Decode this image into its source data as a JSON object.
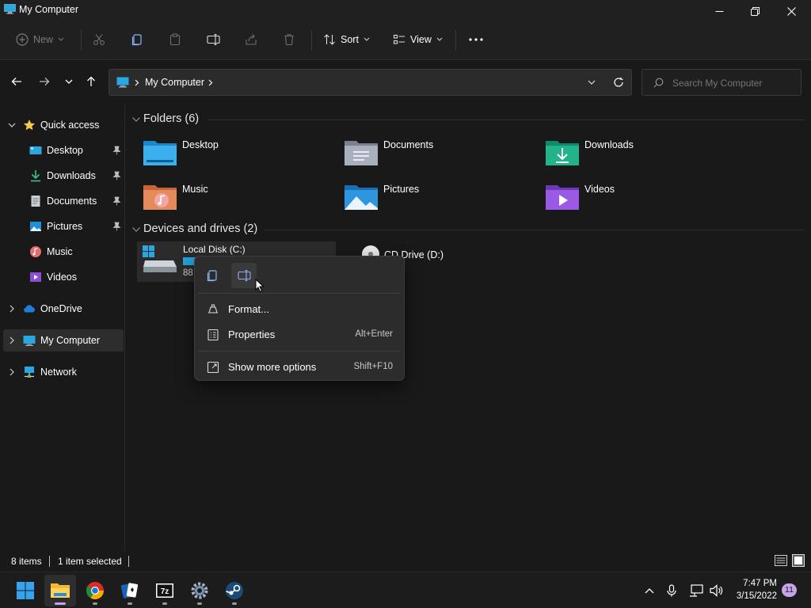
{
  "window": {
    "title": "My Computer",
    "controls": [
      "minimize-icon",
      "restore-icon",
      "close-icon"
    ]
  },
  "toolbar": {
    "new_label": "New",
    "sort_label": "Sort",
    "view_label": "View",
    "icons": [
      "cut-icon",
      "copy-icon",
      "paste-icon",
      "rename-icon",
      "share-icon",
      "delete-icon",
      "more-icon"
    ]
  },
  "address": {
    "breadcrumb": "My Computer",
    "search_placeholder": "Search My Computer"
  },
  "sidebar": {
    "quick_access": "Quick access",
    "items": [
      {
        "label": "Desktop",
        "icon": "desktop-icon",
        "pinned": true
      },
      {
        "label": "Downloads",
        "icon": "downloads-icon",
        "pinned": true
      },
      {
        "label": "Documents",
        "icon": "documents-icon",
        "pinned": true
      },
      {
        "label": "Pictures",
        "icon": "pictures-icon",
        "pinned": true
      },
      {
        "label": "Music",
        "icon": "music-icon",
        "pinned": false
      },
      {
        "label": "Videos",
        "icon": "videos-icon",
        "pinned": false
      }
    ],
    "onedrive": "OneDrive",
    "my_computer": "My Computer",
    "network": "Network"
  },
  "content": {
    "folders_heading": "Folders (6)",
    "folders": [
      {
        "label": "Desktop",
        "icon": "desktop-folder-icon"
      },
      {
        "label": "Documents",
        "icon": "documents-folder-icon"
      },
      {
        "label": "Downloads",
        "icon": "downloads-folder-icon"
      },
      {
        "label": "Music",
        "icon": "music-folder-icon"
      },
      {
        "label": "Pictures",
        "icon": "pictures-folder-icon"
      },
      {
        "label": "Videos",
        "icon": "videos-folder-icon"
      }
    ],
    "drives_heading": "Devices and drives (2)",
    "drive_c": {
      "label": "Local Disk (C:)",
      "free_text": "88",
      "used_fraction": 0.1
    },
    "drive_d": {
      "label": "CD Drive (D:)"
    }
  },
  "context_menu": {
    "top_icons": [
      "copy-icon",
      "rename-icon"
    ],
    "items": [
      {
        "label": "Format...",
        "shortcut": "",
        "icon": "format-icon"
      },
      {
        "label": "Properties",
        "shortcut": "Alt+Enter",
        "icon": "properties-icon"
      },
      {
        "label": "Show more options",
        "shortcut": "Shift+F10",
        "icon": "show-more-icon"
      }
    ]
  },
  "statusbar": {
    "item_count": "8 items",
    "selection": "1 item selected"
  },
  "taskbar": {
    "apps": [
      "start-icon",
      "file-explorer-icon",
      "chrome-icon",
      "solitaire-icon",
      "7zip-icon",
      "settings-icon",
      "steam-icon"
    ],
    "time": "7:47 PM",
    "date": "3/15/2022",
    "notification_count": "11"
  },
  "colors": {
    "accent": "#26a0da",
    "background": "#191919",
    "toolbar": "#202020",
    "menu": "#2c2c2c"
  }
}
